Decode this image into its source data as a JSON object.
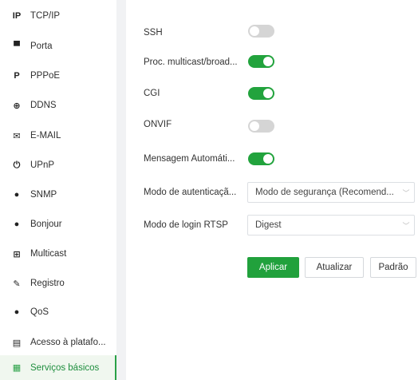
{
  "sidebar": {
    "items": [
      {
        "label": "TCP/IP",
        "icon": "ip-icon",
        "glyph": "IP"
      },
      {
        "label": "Porta",
        "icon": "port-icon",
        "glyph": "▀"
      },
      {
        "label": "PPPoE",
        "icon": "pppoe-icon",
        "glyph": "P"
      },
      {
        "label": "DDNS",
        "icon": "globe-icon",
        "glyph": "⊕"
      },
      {
        "label": "E-MAIL",
        "icon": "mail-icon",
        "glyph": "✉"
      },
      {
        "label": "UPnP",
        "icon": "power-icon",
        "glyph": "⏻"
      },
      {
        "label": "SNMP",
        "icon": "snmp-icon",
        "glyph": "●"
      },
      {
        "label": "Bonjour",
        "icon": "bonjour-icon",
        "glyph": "●"
      },
      {
        "label": "Multicast",
        "icon": "multicast-icon",
        "glyph": "⊞"
      },
      {
        "label": "Registro",
        "icon": "registro-icon",
        "glyph": "✎"
      },
      {
        "label": "QoS",
        "icon": "qos-icon",
        "glyph": "●"
      },
      {
        "label": "Acesso à platafo...",
        "icon": "platform-icon",
        "glyph": "▤"
      },
      {
        "label": "Serviços básicos",
        "icon": "basic-services-icon",
        "glyph": "▦",
        "active": true
      }
    ]
  },
  "settings": {
    "toggles": [
      {
        "label": "SSH",
        "on": false
      },
      {
        "label": "Proc. multicast/broad...",
        "on": true
      },
      {
        "label": "CGI",
        "on": true
      },
      {
        "label": "ONVIF",
        "on": false
      },
      {
        "label": "Mensagem Automáti...",
        "on": true
      }
    ],
    "auth_mode": {
      "label": "Modo de autenticaçã...",
      "value": "Modo de segurança (Recomend..."
    },
    "rtsp_login": {
      "label": "Modo de login RTSP",
      "value": "Digest"
    }
  },
  "buttons": {
    "apply": "Aplicar",
    "refresh": "Atualizar",
    "default": "Padrão"
  },
  "colors": {
    "accent": "#22a33d",
    "toggle_off": "#d5d5d5"
  }
}
